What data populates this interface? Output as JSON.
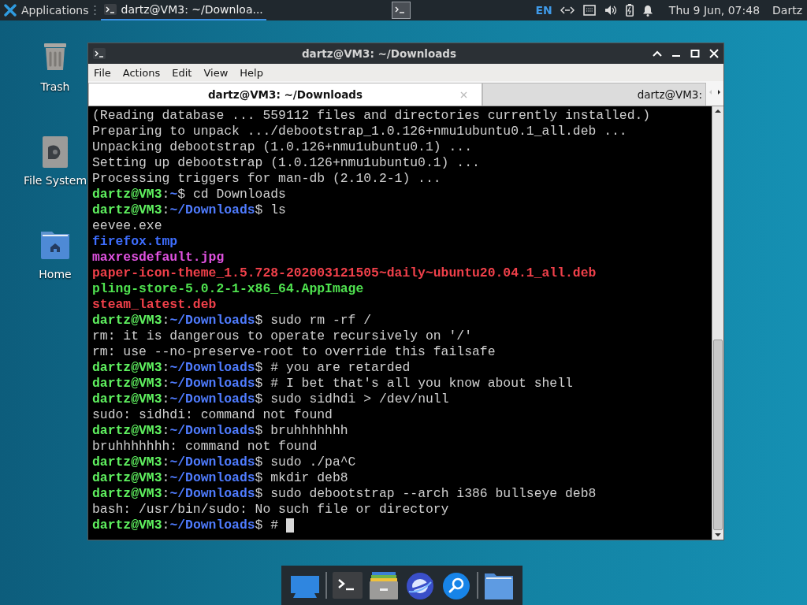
{
  "top_panel": {
    "menu_label": "Applications",
    "task": {
      "title": "dartz@VM3: ~/Downloa..."
    },
    "keyboard_layout": "EN",
    "clock": "Thu  9 Jun, 07:48",
    "user": "Dartz"
  },
  "desktop_icons": [
    {
      "label": "Trash",
      "kind": "trash"
    },
    {
      "label": "File System",
      "kind": "drive"
    },
    {
      "label": "Home",
      "kind": "home"
    }
  ],
  "window": {
    "title": "dartz@VM3: ~/Downloads",
    "menu": [
      "File",
      "Actions",
      "Edit",
      "View",
      "Help"
    ],
    "tabs": [
      {
        "label": "dartz@VM3: ~/Downloads",
        "selected": true
      },
      {
        "label": "dartz@VM3:",
        "selected": false
      }
    ],
    "lines": [
      {
        "kind": "output",
        "text": "(Reading database ... 559112 files and directories currently installed.)"
      },
      {
        "kind": "output",
        "text": "Preparing to unpack .../debootstrap_1.0.126+nmu1ubuntu0.1_all.deb ..."
      },
      {
        "kind": "output",
        "text": "Unpacking debootstrap (1.0.126+nmu1ubuntu0.1) ..."
      },
      {
        "kind": "output",
        "text": "Setting up debootstrap (1.0.126+nmu1ubuntu0.1) ..."
      },
      {
        "kind": "output",
        "text": "Processing triggers for man-db (2.10.2-1) ..."
      },
      {
        "kind": "prompt",
        "user": "dartz@VM3",
        "separator": ":",
        "path": "~",
        "command": "$ cd Downloads"
      },
      {
        "kind": "prompt",
        "user": "dartz@VM3",
        "separator": ":",
        "path": "~/Downloads",
        "command": "$ ls"
      },
      {
        "kind": "output",
        "text": "eevee.exe"
      },
      {
        "kind": "temp",
        "text": "firefox.tmp"
      },
      {
        "kind": "image",
        "text": "maxresdefault.jpg"
      },
      {
        "kind": "archive",
        "text": "paper-icon-theme_1.5.728-202003121505~daily~ubuntu20.04.1_all.deb"
      },
      {
        "kind": "executable",
        "text": "pling-store-5.0.2-1-x86_64.AppImage"
      },
      {
        "kind": "archive",
        "text": "steam_latest.deb"
      },
      {
        "kind": "prompt",
        "user": "dartz@VM3",
        "separator": ":",
        "path": "~/Downloads",
        "command": "$ sudo rm -rf /"
      },
      {
        "kind": "output",
        "text": "rm: it is dangerous to operate recursively on '/'"
      },
      {
        "kind": "output",
        "text": "rm: use --no-preserve-root to override this failsafe"
      },
      {
        "kind": "prompt",
        "user": "dartz@VM3",
        "separator": ":",
        "path": "~/Downloads",
        "command": "$ # you are retarded"
      },
      {
        "kind": "prompt",
        "user": "dartz@VM3",
        "separator": ":",
        "path": "~/Downloads",
        "command": "$ # I bet that's all you know about shell"
      },
      {
        "kind": "prompt",
        "user": "dartz@VM3",
        "separator": ":",
        "path": "~/Downloads",
        "command": "$ sudo sidhdi > /dev/null"
      },
      {
        "kind": "output",
        "text": "sudo: sidhdi: command not found"
      },
      {
        "kind": "prompt",
        "user": "dartz@VM3",
        "separator": ":",
        "path": "~/Downloads",
        "command": "$ bruhhhhhhh"
      },
      {
        "kind": "output",
        "text": "bruhhhhhhh: command not found"
      },
      {
        "kind": "prompt",
        "user": "dartz@VM3",
        "separator": ":",
        "path": "~/Downloads",
        "command": "$ sudo ./pa^C"
      },
      {
        "kind": "prompt",
        "user": "dartz@VM3",
        "separator": ":",
        "path": "~/Downloads",
        "command": "$ mkdir deb8"
      },
      {
        "kind": "prompt",
        "user": "dartz@VM3",
        "separator": ":",
        "path": "~/Downloads",
        "command": "$ sudo debootstrap --arch i386 bullseye deb8"
      },
      {
        "kind": "output",
        "text": "bash: /usr/bin/sudo: No such file or directory"
      },
      {
        "kind": "prompt",
        "user": "dartz@VM3",
        "separator": ":",
        "path": "~/Downloads",
        "command": "$ # ",
        "cursor": true
      }
    ]
  },
  "dock": [
    {
      "kind": "desktop"
    },
    {
      "kind": "separator"
    },
    {
      "kind": "terminal"
    },
    {
      "kind": "files-cabinet"
    },
    {
      "kind": "browser"
    },
    {
      "kind": "search"
    },
    {
      "kind": "separator"
    },
    {
      "kind": "folder"
    }
  ]
}
